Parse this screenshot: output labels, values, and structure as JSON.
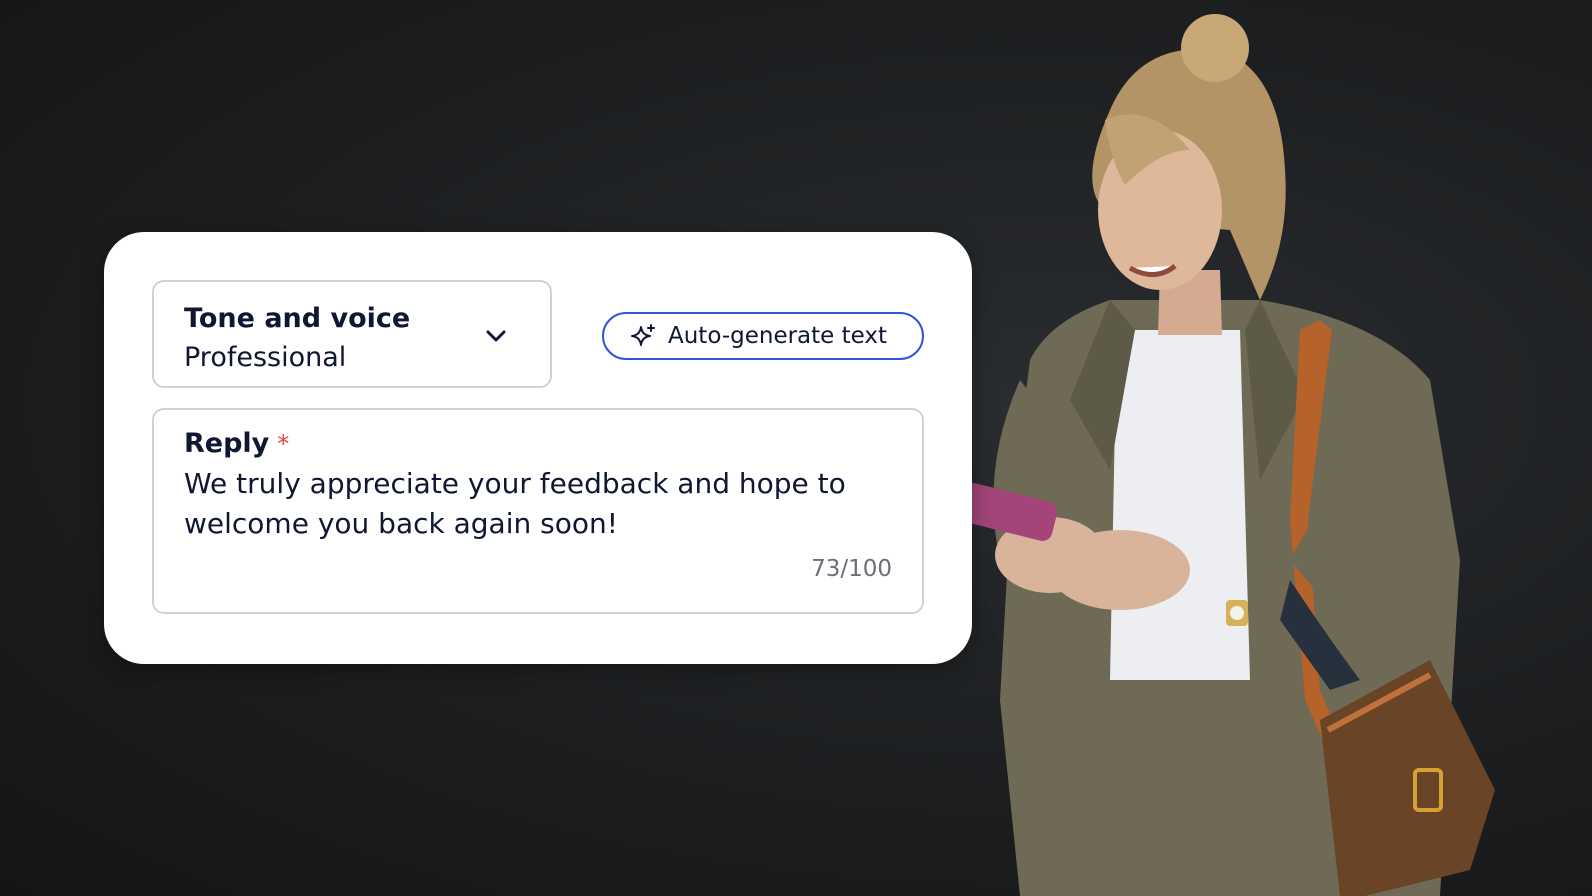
{
  "tone_select": {
    "label": "Tone and voice",
    "value": "Professional",
    "icon": "chevron-down-icon"
  },
  "auto_generate": {
    "label": "Auto-generate text",
    "icon": "sparkle-icon",
    "accent": "#2f56d8"
  },
  "reply": {
    "label": "Reply",
    "required_mark": "*",
    "text": "We truly appreciate your feedback and hope to welcome you back again soon!",
    "counter": "73/100"
  },
  "colors": {
    "background": "#1c1e20",
    "text": "#0f1733",
    "required": "#e2453a"
  }
}
